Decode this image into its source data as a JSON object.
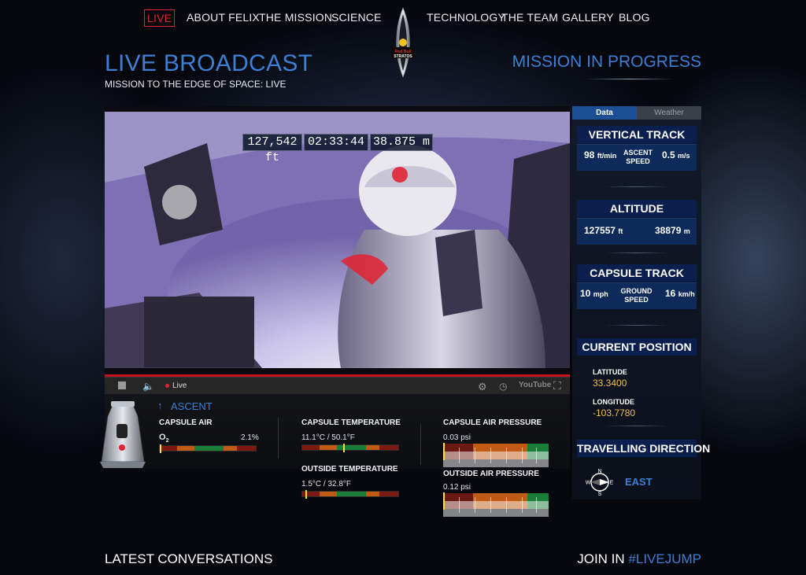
{
  "nav": {
    "items": [
      "LIVE",
      "ABOUT FELIX",
      "THE MISSION",
      "SCIENCE",
      "TECHNOLOGY",
      "THE TEAM",
      "GALLERY",
      "BLOG"
    ],
    "logo_text": "Red Bull STRATOS"
  },
  "header": {
    "title": "LIVE BROADCAST",
    "subtitle": "MISSION TO THE EDGE OF SPACE: LIVE",
    "status": "MISSION IN PROGRESS"
  },
  "video": {
    "overlay_altitude_ft": "127,542 ft",
    "overlay_time": "02:33:44",
    "overlay_altitude_m": "38.875 m",
    "player_live_label": "Live",
    "youtube_label": "YouTube"
  },
  "telemetry": {
    "phase": "ASCENT",
    "capsule_air_label": "CAPSULE AIR",
    "o2_label": "O",
    "o2_sub": "2",
    "o2_value": "2.1%",
    "capsule_temp_label": "CAPSULE TEMPERATURE",
    "capsule_temp_value": "11.1°C / 50.1°F",
    "outside_temp_label": "OUTSIDE TEMPERATURE",
    "outside_temp_value": "1.5°C / 32.8°F",
    "capsule_pressure_label": "CAPSULE AIR PRESSURE",
    "capsule_pressure_value": "0.03 psi",
    "outside_pressure_label": "OUTSIDE AIR PRESSURE",
    "outside_pressure_value": "0.12 psi"
  },
  "panel": {
    "tabs": [
      "Data",
      "Weather"
    ],
    "vertical_track": {
      "title": "VERTICAL TRACK",
      "left_value": "98",
      "left_unit": "ft/min",
      "mid_label_1": "ASCENT",
      "mid_label_2": "SPEED",
      "right_value": "0.5",
      "right_unit": "m/s"
    },
    "altitude": {
      "title": "ALTITUDE",
      "left_value": "127557",
      "left_unit": "ft",
      "right_value": "38879",
      "right_unit": "m"
    },
    "capsule_track": {
      "title": "CAPSULE TRACK",
      "left_value": "10",
      "left_unit": "mph",
      "mid_label_1": "GROUND",
      "mid_label_2": "SPEED",
      "right_value": "16",
      "right_unit": "km/h"
    },
    "current_position": {
      "title": "CURRENT POSITION",
      "latitude_label": "LATITUDE",
      "latitude_value": "33.3400",
      "longitude_label": "LONGITUDE",
      "longitude_value": "-103.7780"
    },
    "travelling_direction": {
      "title": "TRAVELLING DIRECTION",
      "value": "EAST",
      "compass": [
        "N",
        "E",
        "S",
        "W"
      ]
    }
  },
  "footer": {
    "latest": "LATEST CONVERSATIONS",
    "join": "JOIN IN",
    "hashtag": "#LIVEJUMP"
  },
  "colors": {
    "accent_blue": "#3d7fd4",
    "live_red": "#e02333",
    "position_gold": "#f2c14a"
  }
}
